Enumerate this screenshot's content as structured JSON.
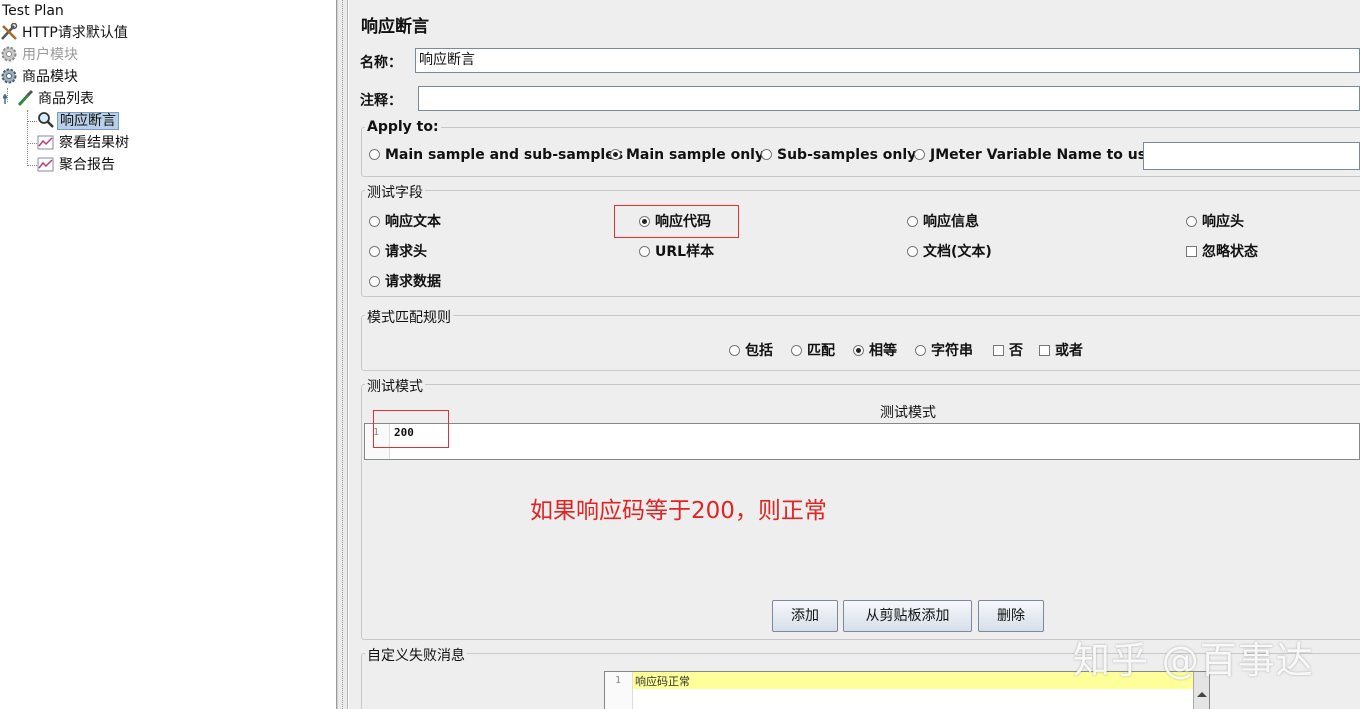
{
  "tree": {
    "root": "Test Plan",
    "http_defaults": "HTTP请求默认值",
    "user_module": "用户模块",
    "goods_module": "商品模块",
    "goods_list": "商品列表",
    "response_assertion": "响应断言",
    "view_results_tree": "察看结果树",
    "aggregate_report": "聚合报告"
  },
  "panel": {
    "title": "响应断言",
    "name_label": "名称：",
    "name_value": "响应断言",
    "comment_label": "注释：",
    "comment_value": ""
  },
  "apply_to": {
    "legend": "Apply to:",
    "options": [
      "Main sample and sub-samples",
      "Main sample only",
      "Sub-samples only",
      "JMeter Variable Name to use"
    ],
    "selected": "Main sample only",
    "variable_value": ""
  },
  "test_field": {
    "legend": "测试字段",
    "options": [
      "响应文本",
      "响应代码",
      "响应信息",
      "响应头",
      "请求头",
      "URL样本",
      "文档(文本)",
      "请求数据"
    ],
    "selected": "响应代码",
    "ignore_status_label": "忽略状态",
    "ignore_status_checked": false
  },
  "pattern_rules": {
    "legend": "模式匹配规则",
    "options": [
      "包括",
      "匹配",
      "相等",
      "字符串"
    ],
    "selected": "相等",
    "not_label": "否",
    "or_label": "或者"
  },
  "test_patterns": {
    "legend": "测试模式",
    "column_header": "测试模式",
    "rows": [
      {
        "line": "1",
        "value": "200"
      }
    ]
  },
  "annotation": "如果响应码等于200，则正常",
  "buttons": {
    "add": "添加",
    "add_from_clipboard": "从剪贴板添加",
    "delete": "删除"
  },
  "failure_message": {
    "legend": "自定义失败消息",
    "line": "1",
    "value": "响应码正常"
  },
  "watermark": "知乎 @百事达",
  "colors": {
    "annotation_red": "#e02424",
    "selection_blue": "#b8cfe5",
    "editor_highlight": "#ffff99"
  }
}
